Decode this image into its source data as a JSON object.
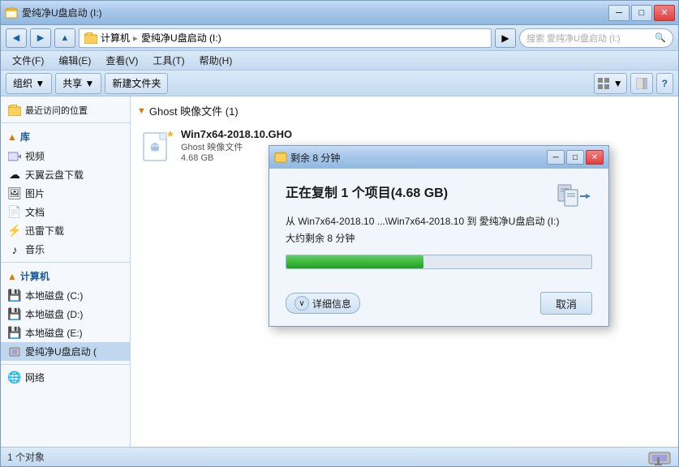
{
  "window": {
    "title": "愛纯净U盘启动 (I:)",
    "path_parts": [
      "计算机",
      "愛纯净U盘启动 (I:)"
    ],
    "search_placeholder": "搜索 愛纯净U盘启动 (I:)",
    "min_label": "─",
    "max_label": "□",
    "close_label": "✕"
  },
  "menu": {
    "items": [
      "文件(F)",
      "编辑(E)",
      "查看(V)",
      "工具(T)",
      "帮助(H)"
    ]
  },
  "toolbar": {
    "organize_label": "组织 ▼",
    "share_label": "共享 ▼",
    "new_folder_label": "新建文件夹"
  },
  "sidebar": {
    "recent_label": "最近访问的位置",
    "library_label": "库",
    "video_label": "视频",
    "cloud_label": "天翼云盘下载",
    "picture_label": "图片",
    "doc_label": "文档",
    "thunder_label": "迅雷下载",
    "music_label": "音乐",
    "computer_label": "计算机",
    "disk_c_label": "本地磁盘 (C:)",
    "disk_d_label": "本地磁盘 (D:)",
    "disk_e_label": "本地磁盘 (E:)",
    "usb_label": "愛纯净U盘启动 (",
    "network_label": "网络"
  },
  "content": {
    "folder_name": "Ghost 映像文件 (1)",
    "file_name": "Win7x64-2018.10.GHO",
    "file_type": "Ghost 映像文件",
    "file_size": "4.68 GB"
  },
  "status_bar": {
    "text": "1 个对象"
  },
  "dialog": {
    "title": "剩余 8 分钟",
    "main_title": "正在复制 1 个项目(4.68 GB)",
    "from_text": "从 Win7x64-2018.10 ...\\Win7x64-2018.10 到 愛纯净U盘启动 (I:)",
    "time_text": "大约剩余 8 分钟",
    "progress_percent": 45,
    "detail_label": "详细信息",
    "cancel_label": "取消",
    "min_label": "─",
    "max_label": "□",
    "close_label": "✕"
  }
}
